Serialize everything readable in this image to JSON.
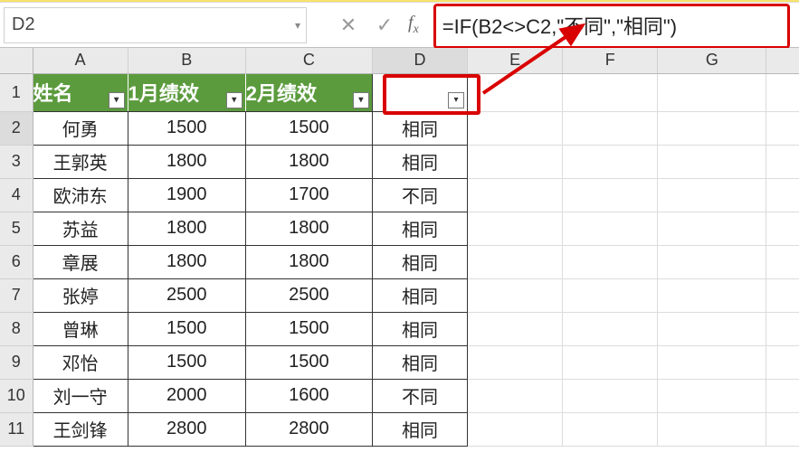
{
  "namebox": {
    "value": "D2"
  },
  "formula": {
    "text": "=IF(B2<>C2,\"不同\",\"相同\")"
  },
  "columns": [
    "A",
    "B",
    "C",
    "D",
    "E",
    "F",
    "G"
  ],
  "col_classes": [
    "col-A",
    "col-B",
    "col-C",
    "col-D",
    "col-E",
    "col-F",
    "col-G"
  ],
  "selected_col_index": 3,
  "header_row": {
    "A": "姓名",
    "B": "1月绩效",
    "C": "2月绩效",
    "D": ""
  },
  "rows": [
    {
      "n": 1,
      "is_header": true
    },
    {
      "n": 2,
      "A": "何勇",
      "B": "1500",
      "C": "1500",
      "D": "相同",
      "selected": true
    },
    {
      "n": 3,
      "A": "王郭英",
      "B": "1800",
      "C": "1800",
      "D": "相同"
    },
    {
      "n": 4,
      "A": "欧沛东",
      "B": "1900",
      "C": "1700",
      "D": "不同"
    },
    {
      "n": 5,
      "A": "苏益",
      "B": "1800",
      "C": "1800",
      "D": "相同"
    },
    {
      "n": 6,
      "A": "章展",
      "B": "1800",
      "C": "1800",
      "D": "相同"
    },
    {
      "n": 7,
      "A": "张婷",
      "B": "2500",
      "C": "2500",
      "D": "相同"
    },
    {
      "n": 8,
      "A": "曾琳",
      "B": "1500",
      "C": "1500",
      "D": "相同"
    },
    {
      "n": 9,
      "A": "邓怡",
      "B": "1500",
      "C": "1500",
      "D": "相同"
    },
    {
      "n": 10,
      "A": "刘一守",
      "B": "2000",
      "C": "1600",
      "D": "不同"
    },
    {
      "n": 11,
      "A": "王剑锋",
      "B": "2800",
      "C": "2800",
      "D": "相同"
    }
  ],
  "icons": {
    "cancel": "✕",
    "confirm": "✓",
    "dropdown": "▾"
  }
}
